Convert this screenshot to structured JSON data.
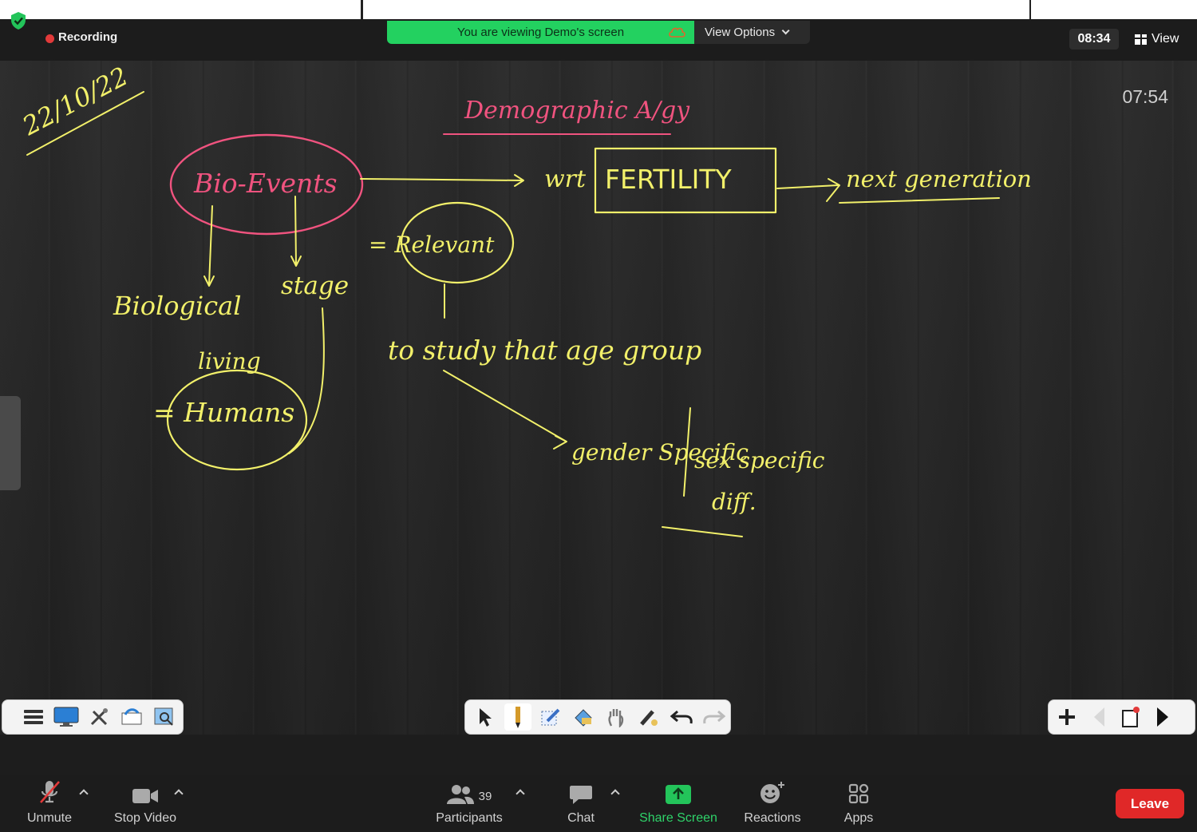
{
  "header": {
    "recording_label": "Recording",
    "viewing_banner": "You are viewing Demo's screen",
    "view_options_label": "View Options",
    "meeting_clock": "08:34",
    "view_label": "View"
  },
  "share": {
    "slide_timer": "07:54",
    "whiteboard_text": {
      "date": "22/10/22",
      "title": "Demographic A/gy",
      "bio_events": "Bio-Events",
      "wrt": "wrt",
      "fertility": "FERTILITY",
      "next_generation": "next generation",
      "relevant": "= Relevant",
      "biological": "Biological",
      "stage": "stage",
      "living": "living",
      "humans": "= Humans",
      "study_group": "to study that age group",
      "gender_specific": "gender Specific",
      "sex_specific": "sex specific",
      "diff": "diff."
    },
    "ink_colors": {
      "pink": "#f0537f",
      "yellow": "#f2f06a"
    }
  },
  "whiteboard_toolbar": {
    "left_icons": [
      "menu-icon",
      "screen-icon",
      "tools-icon",
      "share-board-icon",
      "image-search-icon"
    ],
    "middle_icons": [
      "pointer-icon",
      "pencil-icon",
      "edit-icon",
      "eraser-icon",
      "hand-icon",
      "highlighter-icon",
      "undo-icon",
      "redo-icon"
    ],
    "right_icons": [
      "add-page-icon",
      "prev-page-icon",
      "page-counter-icon",
      "next-page-icon"
    ]
  },
  "controls": {
    "unmute": "Unmute",
    "stop_video": "Stop Video",
    "participants": "Participants",
    "participants_count": "39",
    "chat": "Chat",
    "share_screen": "Share Screen",
    "reactions": "Reactions",
    "apps": "Apps",
    "leave": "Leave"
  }
}
